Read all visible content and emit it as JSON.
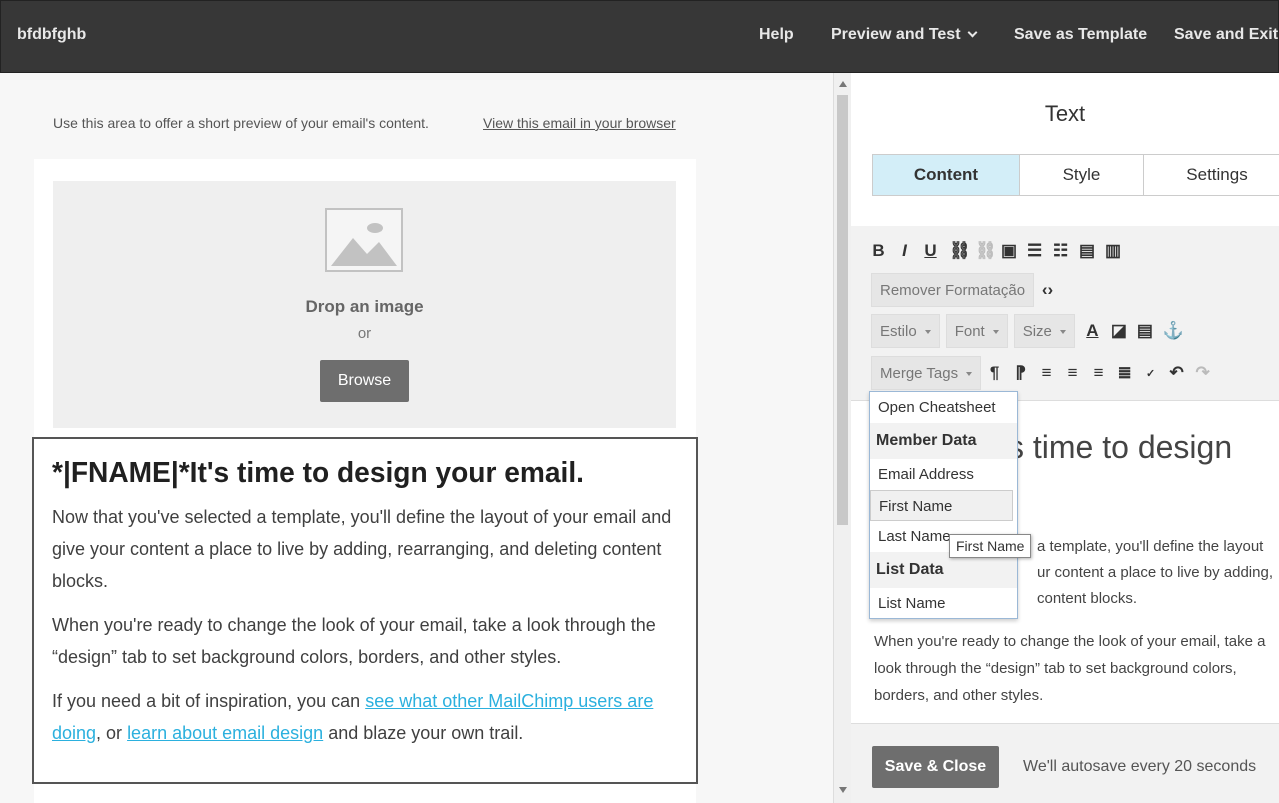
{
  "topbar": {
    "campaign_name": "bfdbfghb",
    "help": "Help",
    "preview_test": "Preview and Test",
    "save_template": "Save as Template",
    "save_exit": "Save and Exit"
  },
  "left": {
    "preheader": "Use this area to offer a short preview of your email's content.",
    "view_in_browser": "View this email in your browser",
    "image_block": {
      "drop": "Drop an image",
      "or": "or",
      "browse": "Browse"
    },
    "text_block": {
      "heading": "*|FNAME|*It's time to design your email.",
      "p1": "Now that you've selected a template, you'll define the layout of your email and give your content a place to live by adding, rearranging, and deleting content blocks.",
      "p2": "When you're ready to change the look of your email, take a look through the “design” tab to set background colors, borders, and other styles.",
      "p3_prefix": "If you need a bit of inspiration, you can ",
      "p3_link1": "see what other MailChimp users are doing",
      "p3_middle": ", or ",
      "p3_link2": "learn about email design",
      "p3_suffix": " and blaze your own trail."
    }
  },
  "panel": {
    "title": "Text",
    "tabs": [
      "Content",
      "Style",
      "Settings"
    ],
    "remove_format": "Remover Formatação",
    "style_select": "Estilo",
    "font_select": "Font",
    "size_select": "Size",
    "merge_tags": "Merge Tags",
    "editor": {
      "heading_partial": "s time to design",
      "p1_lines": [
        "a template, you'll define the layout",
        "ur content a place to live by adding,",
        "content blocks."
      ],
      "p2_lines": [
        "When you're ready to change the look of your email, take a",
        "look through the “design” tab to set background colors,",
        "borders, and other styles."
      ]
    },
    "merge_dropdown": {
      "items": [
        "Open Cheatsheet",
        "Member Data",
        "Email Address",
        "First Name",
        "Last Name",
        "List Data",
        "List Name"
      ]
    },
    "tooltip": "First Name",
    "save_close": "Save & Close",
    "autosave": "We'll autosave every 20 seconds"
  }
}
